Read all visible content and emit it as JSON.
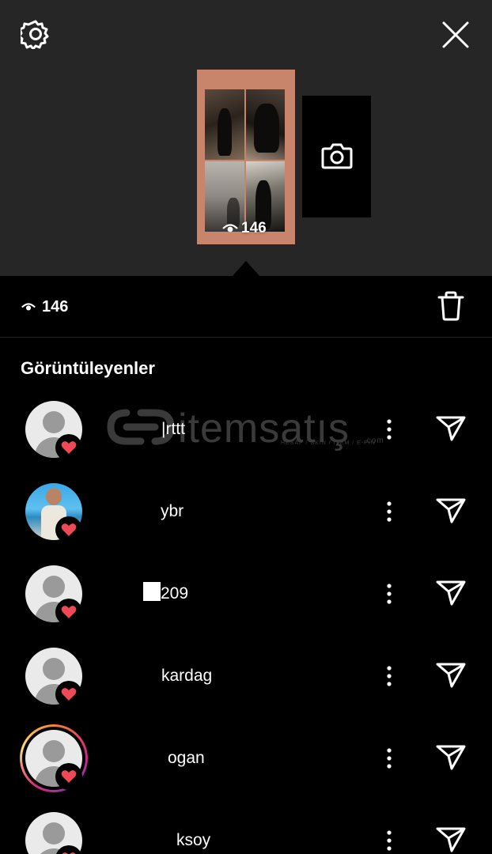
{
  "icons": {
    "settings": "gear-icon",
    "close": "close-icon",
    "camera": "camera-icon",
    "eye": "eye-icon",
    "trash": "trash-icon",
    "more": "more-vertical-icon",
    "send": "send-icon",
    "heart": "heart-icon"
  },
  "colors": {
    "top_bg": "#262626",
    "body_bg": "#000000",
    "heart": "#ed4956",
    "thumb_frame": "#c9846c"
  },
  "story": {
    "thumb_views": "146"
  },
  "stats": {
    "views": "146"
  },
  "viewers": {
    "title": "Görüntüleyenler",
    "items": [
      {
        "username": "|rttt",
        "avatar": "default",
        "liked": true
      },
      {
        "username": "ybr",
        "avatar": "photo",
        "liked": true
      },
      {
        "username": "209",
        "avatar": "default",
        "liked": true
      },
      {
        "username": "kardag",
        "avatar": "default",
        "liked": true
      },
      {
        "username": "ogan",
        "avatar": "default-story-ring",
        "liked": true
      },
      {
        "username": "ksoy",
        "avatar": "default",
        "liked": true
      }
    ]
  },
  "watermark": {
    "text": "itemsatış",
    "sub": "HESAP / SKIN / ITEM / E-PIN",
    "domain": ".com"
  }
}
